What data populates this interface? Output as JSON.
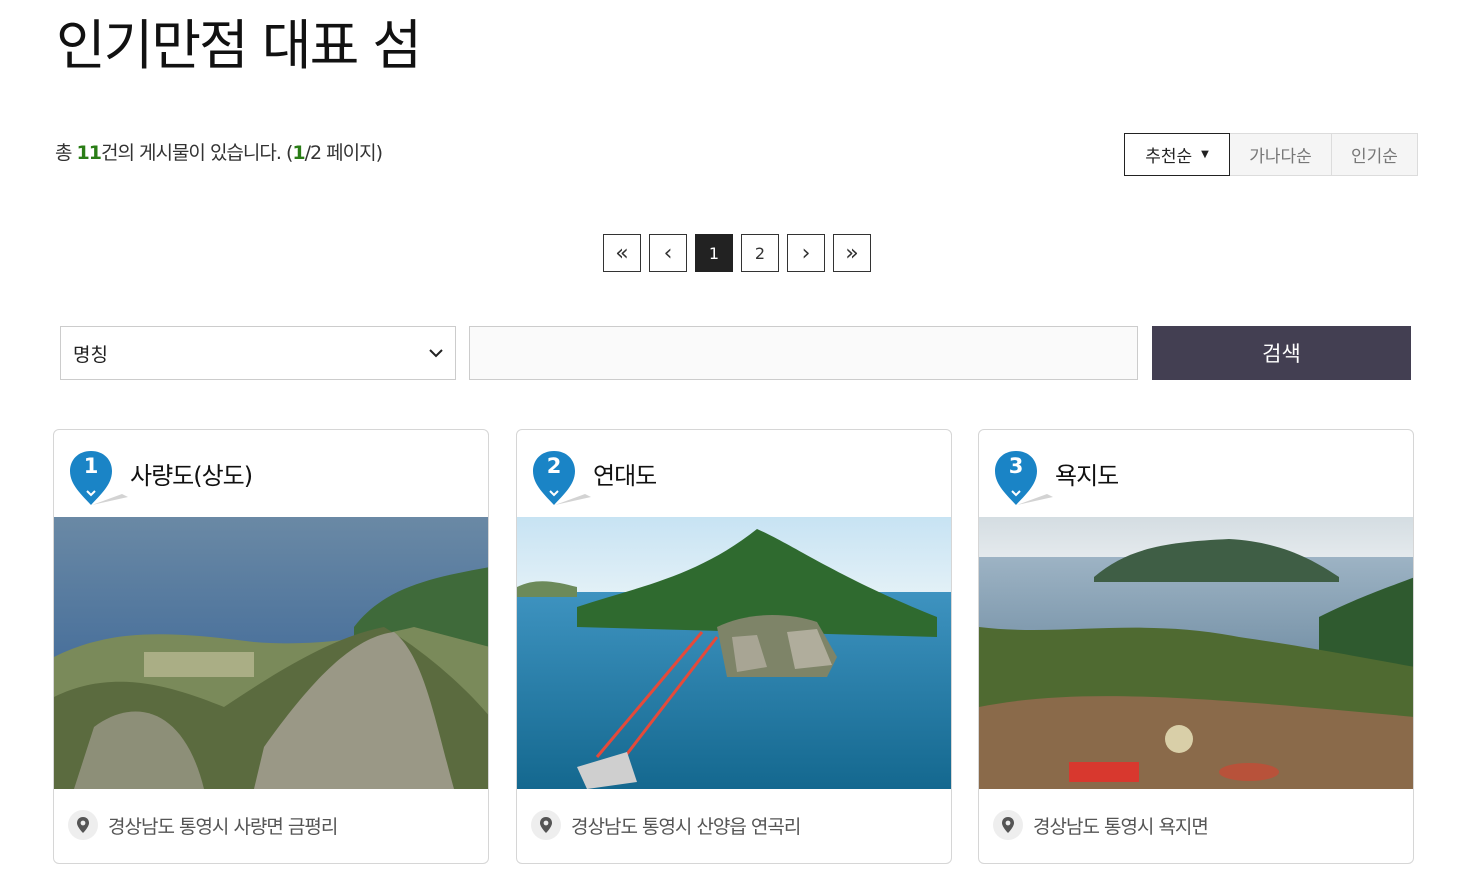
{
  "page": {
    "title": "인기만점 대표 섬"
  },
  "summary": {
    "prefix": "총",
    "total": "11",
    "middle": "건의 게시물이 있습니다. (",
    "current_page": "1",
    "suffix": "/2 페이지)"
  },
  "sort": {
    "options": [
      "추천순",
      "가나다순",
      "인기순"
    ],
    "active": "추천순"
  },
  "pagination": {
    "first": "«",
    "prev": "‹",
    "pages": [
      "1",
      "2"
    ],
    "current": "1",
    "next": "›",
    "last": "»"
  },
  "search": {
    "field_value": "명칭",
    "input_value": "",
    "button_label": "검색"
  },
  "colors": {
    "accent": "#1a84c6",
    "highlight": "#2a7d16",
    "search_button": "#433f52"
  },
  "cards": [
    {
      "number": "1",
      "name": "사량도(상도)",
      "location": "경상남도 통영시 사량면 금평리"
    },
    {
      "number": "2",
      "name": "연대도",
      "location": "경상남도 통영시 산양읍 연곡리"
    },
    {
      "number": "3",
      "name": "욕지도",
      "location": "경상남도 통영시 욕지면"
    }
  ]
}
